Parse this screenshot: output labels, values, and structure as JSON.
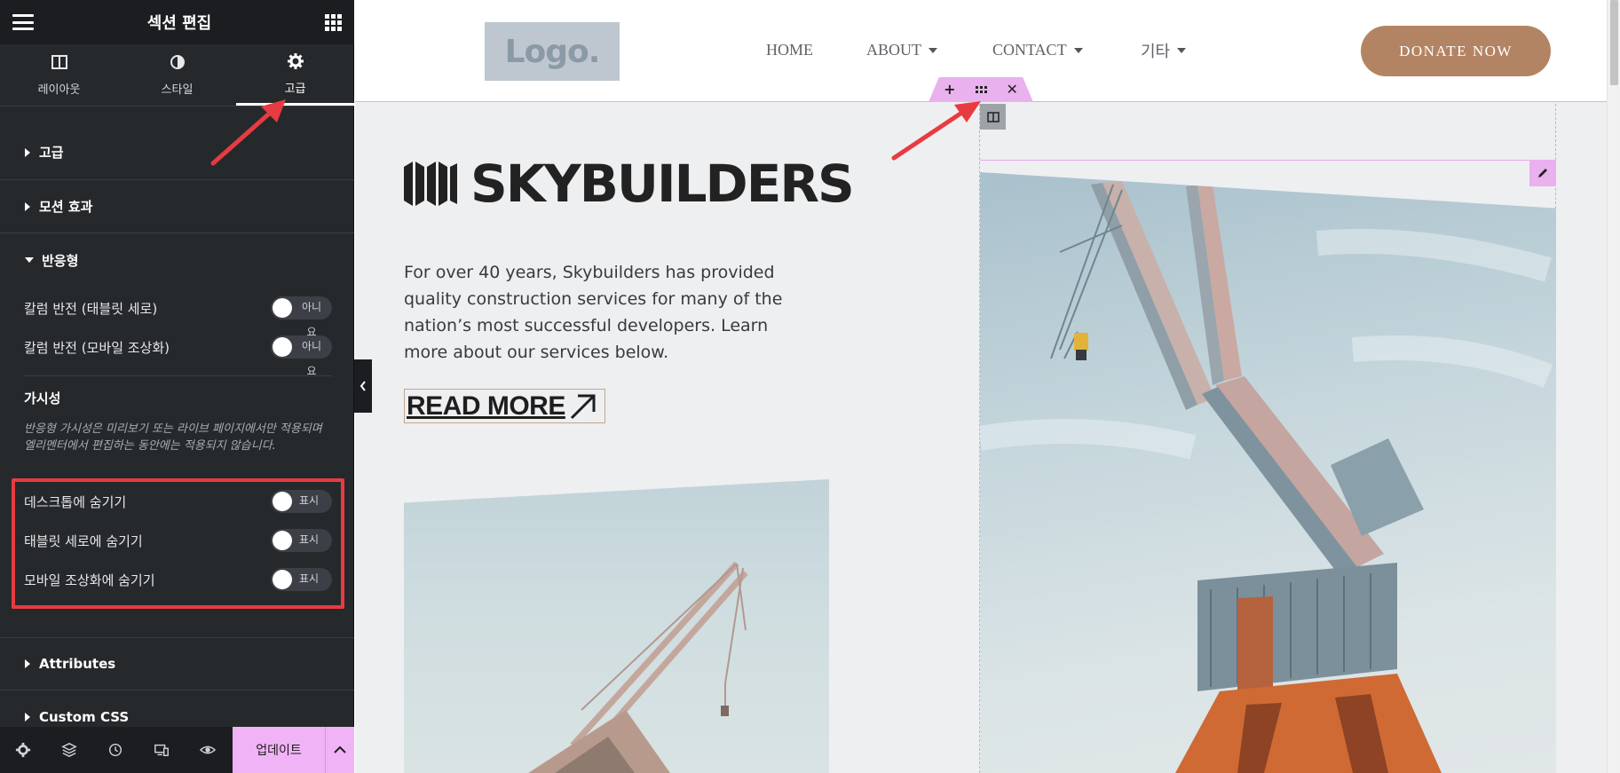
{
  "sidebar": {
    "title": "섹션 편집",
    "tabs": [
      {
        "label": "레이아웃",
        "icon": "layout-icon"
      },
      {
        "label": "스타일",
        "icon": "style-icon"
      },
      {
        "label": "고급",
        "icon": "gear-icon",
        "active": true
      }
    ],
    "sections": {
      "advanced": "고급",
      "motion": "모션 효과",
      "responsive": "반응형",
      "attributes": "Attributes",
      "custom_css": "Custom CSS"
    },
    "responsive": {
      "reverse_tablet": {
        "label": "칼럼 반전 (태블릿 세로)",
        "toggle_text": "아니요",
        "on": false
      },
      "reverse_mobile": {
        "label": "칼럼 반전 (모바일 조상화)",
        "toggle_text": "아니요",
        "on": false
      }
    },
    "visibility": {
      "title": "가시성",
      "note": "반응형 가시성은 미리보기 또는 라이브 페이지에서만 적용되며 엘리멘터에서 편집하는 동안에는 적용되지 않습니다.",
      "hide_desktop": {
        "label": "데스크톱에 숨기기",
        "toggle_text": "표시",
        "on": false
      },
      "hide_tablet": {
        "label": "태블릿 세로에 숨기기",
        "toggle_text": "표시",
        "on": false
      },
      "hide_mobile": {
        "label": "모바일 조상화에 숨기기",
        "toggle_text": "표시",
        "on": false
      }
    },
    "footer": {
      "update_label": "업데이트",
      "icons": [
        "settings-icon",
        "layers-icon",
        "history-icon",
        "responsive-icon",
        "eye-icon"
      ]
    }
  },
  "preview": {
    "logo_text": "Logo.",
    "nav": [
      {
        "label": "HOME",
        "dropdown": false
      },
      {
        "label": "ABOUT",
        "dropdown": true
      },
      {
        "label": "CONTACT",
        "dropdown": true
      },
      {
        "label": "기타",
        "dropdown": true
      }
    ],
    "donate_label": "DONATE NOW",
    "brand": "SKYBUILDERS",
    "intro": "For over 40 years, Skybuilders has provided quality construction services for many of the nation’s most successful developers. Learn more about our services below.",
    "read_more": "READ MORE"
  },
  "colors": {
    "sidebar_bg": "#26292c",
    "accent_pink": "#f0b3f5",
    "donate_brown": "#b38463",
    "highlight_red": "#e83b41"
  }
}
